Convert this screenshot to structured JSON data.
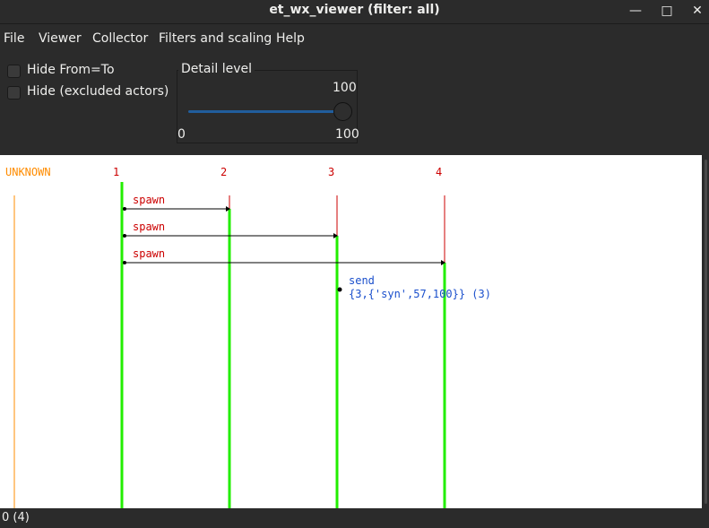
{
  "window": {
    "title": "et_wx_viewer (filter: all)",
    "minimize_glyph": "—",
    "maximize_glyph": "□",
    "close_glyph": "✕"
  },
  "menu": [
    "File",
    "Viewer",
    "Collector",
    "Filters and scaling",
    "Help"
  ],
  "options": {
    "hide_from_to": {
      "label": "Hide From=To",
      "checked": false
    },
    "hide_excluded": {
      "label": "Hide (excluded actors)",
      "checked": false
    }
  },
  "detail": {
    "title": "Detail level",
    "value": "100",
    "min": "0",
    "max": "100",
    "level": 1.0
  },
  "sequence": {
    "colors": {
      "actor_label": "#cc0000",
      "unknown": "#ff8c00",
      "lifeline_active": "#22ee00",
      "event_label": "#cc0000",
      "send_label": "#1a4fcc"
    },
    "actors": [
      "UNKNOWN",
      "1",
      "2",
      "3",
      "4"
    ],
    "events": [
      {
        "label": "spawn",
        "from": "1",
        "to": "2"
      },
      {
        "label": "spawn",
        "from": "1",
        "to": "3"
      },
      {
        "label": "spawn",
        "from": "1",
        "to": "4"
      }
    ],
    "send": {
      "label": "send",
      "detail": "{3,{'syn',57,100}} (3)",
      "actor": "3"
    }
  },
  "status": {
    "text": "0 (4)"
  }
}
